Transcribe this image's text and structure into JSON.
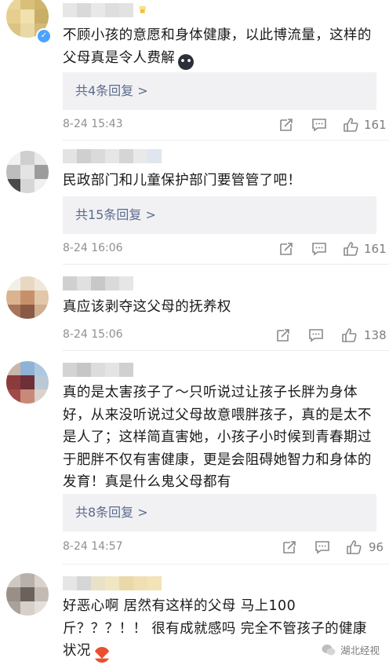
{
  "comments": [
    {
      "text": "不顾小孩的意愿和身体健康，以此博流量，这样的父母真是令人费解",
      "emoji": "crying-face-icon",
      "replies_label": "共4条回复 >",
      "time": "8-24 15:43",
      "likes": "161"
    },
    {
      "text": "民政部门和儿童保护部门要管管了吧！",
      "replies_label": "共15条回复 >",
      "time": "8-24 16:06",
      "likes": "161"
    },
    {
      "text": "真应该剥夺这父母的抚养权",
      "time": "8-24 15:06",
      "likes": "138"
    },
    {
      "text": "真的是太害孩子了～只听说过让孩子长胖为身体好，从来没听说过父母故意喂胖孩子，真的是太不是人了；这样简直害她，小孩子小时候到青春期过于肥胖不仅有害健康，更是会阻碍她智力和身体的发育！真是什么鬼父母都有",
      "replies_label": "共8条回复 >",
      "time": "8-24 14:57",
      "likes": "96"
    },
    {
      "text": "好恶心啊 居然有这样的父母 马上100斤？？？！！ 很有成就感吗 完全不管孩子的健康状况",
      "emoji": "angry-face-icon"
    }
  ],
  "watermark": "湖北经视",
  "colors": {
    "reply_text": "#5b6b8c",
    "reply_bg": "#f1f1f4",
    "meta": "#8f8f8f"
  }
}
